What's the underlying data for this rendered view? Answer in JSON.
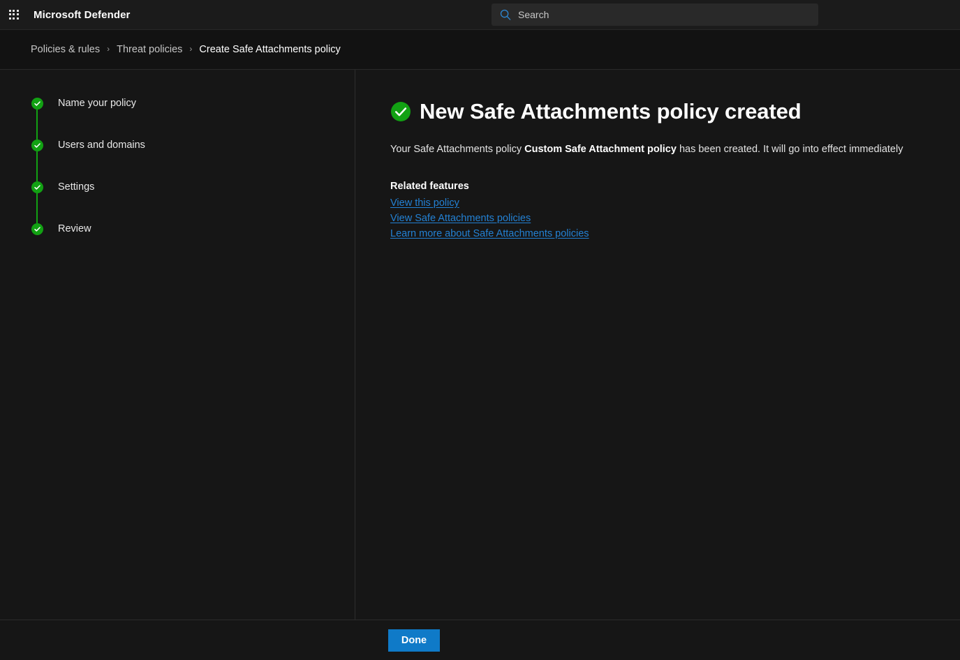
{
  "header": {
    "waffle_icon": "app-launcher-grid-icon",
    "brand": "Microsoft Defender",
    "search": {
      "icon": "search-icon",
      "placeholder": "Search",
      "value": ""
    }
  },
  "breadcrumb": {
    "separator": "›",
    "items": [
      {
        "label": "Policies & rules",
        "current": false
      },
      {
        "label": "Threat policies",
        "current": false
      },
      {
        "label": "Create Safe Attachments policy",
        "current": true
      }
    ]
  },
  "wizard": {
    "steps": [
      {
        "label": "Name your policy",
        "state": "complete",
        "icon": "check-circle-icon"
      },
      {
        "label": "Users and domains",
        "state": "complete",
        "icon": "check-circle-icon"
      },
      {
        "label": "Settings",
        "state": "complete",
        "icon": "check-circle-icon"
      },
      {
        "label": "Review",
        "state": "complete",
        "icon": "check-circle-icon"
      }
    ]
  },
  "main": {
    "status_icon": "check-circle-icon",
    "title": "New Safe Attachments policy created",
    "description_prefix": "Your Safe Attachments policy ",
    "description_policy_name": "Custom Safe Attachment policy",
    "description_suffix": " has been created. It will go into effect immediately",
    "related_heading": "Related features",
    "links": [
      "View this policy",
      "View Safe Attachments policies",
      "Learn more about Safe Attachments policies"
    ]
  },
  "footer": {
    "done_label": "Done"
  },
  "colors": {
    "accent_blue": "#0f7ac8",
    "link_blue": "#2381d4",
    "success_green": "#12a113",
    "page_background": "#121212",
    "panel_background": "#161616",
    "header_background": "#1b1b1b"
  }
}
